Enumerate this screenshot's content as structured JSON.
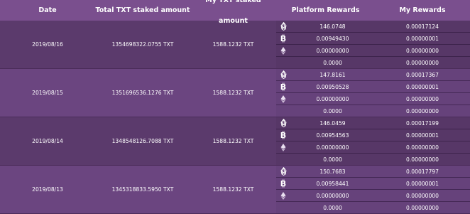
{
  "headers": {
    "date": "Date",
    "total": "Total TXT staked amount",
    "mine": "My TXT staked amount",
    "platform": "Platform Rewards",
    "my": "My Rewards"
  },
  "rows": [
    {
      "date": "2019/08/16",
      "total": "1354698322.0755 TXT",
      "mine": "1588.1232 TXT",
      "rewards": [
        {
          "icon": "eos-icon",
          "platform": "146.0748",
          "my": "0.00017124"
        },
        {
          "icon": "bitcoin-icon",
          "platform": "0.00949430",
          "my": "0.00000001"
        },
        {
          "icon": "ethereum-icon",
          "platform": "0.00000000",
          "my": "0.00000000"
        },
        {
          "icon": "",
          "platform": "0.0000",
          "my": "0.00000000"
        }
      ]
    },
    {
      "date": "2019/08/15",
      "total": "1351696536.1276 TXT",
      "mine": "1588.1232 TXT",
      "rewards": [
        {
          "icon": "eos-icon",
          "platform": "147.8161",
          "my": "0.00017367"
        },
        {
          "icon": "bitcoin-icon",
          "platform": "0.00950528",
          "my": "0.00000001"
        },
        {
          "icon": "ethereum-icon",
          "platform": "0.00000000",
          "my": "0.00000000"
        },
        {
          "icon": "",
          "platform": "0.0000",
          "my": "0.00000000"
        }
      ]
    },
    {
      "date": "2019/08/14",
      "total": "1348548126.7088 TXT",
      "mine": "1588.1232 TXT",
      "rewards": [
        {
          "icon": "eos-icon",
          "platform": "146.0459",
          "my": "0.00017199"
        },
        {
          "icon": "bitcoin-icon",
          "platform": "0.00954563",
          "my": "0.00000001"
        },
        {
          "icon": "ethereum-icon",
          "platform": "0.00000000",
          "my": "0.00000000"
        },
        {
          "icon": "",
          "platform": "0.0000",
          "my": "0.00000000"
        }
      ]
    },
    {
      "date": "2019/08/13",
      "total": "1345318833.5950 TXT",
      "mine": "1588.1232 TXT",
      "rewards": [
        {
          "icon": "eos-icon",
          "platform": "150.7683",
          "my": "0.00017797"
        },
        {
          "icon": "bitcoin-icon",
          "platform": "0.00958441",
          "my": "0.00000001"
        },
        {
          "icon": "ethereum-icon",
          "platform": "0.00000000",
          "my": "0.00000000"
        },
        {
          "icon": "",
          "platform": "0.0000",
          "my": "0.00000000"
        }
      ]
    }
  ],
  "colors": {
    "header_bg": "#7a4f8e",
    "row_dark": "#5b3a6c",
    "row_light": "#6b4580",
    "text": "#ffffff"
  }
}
